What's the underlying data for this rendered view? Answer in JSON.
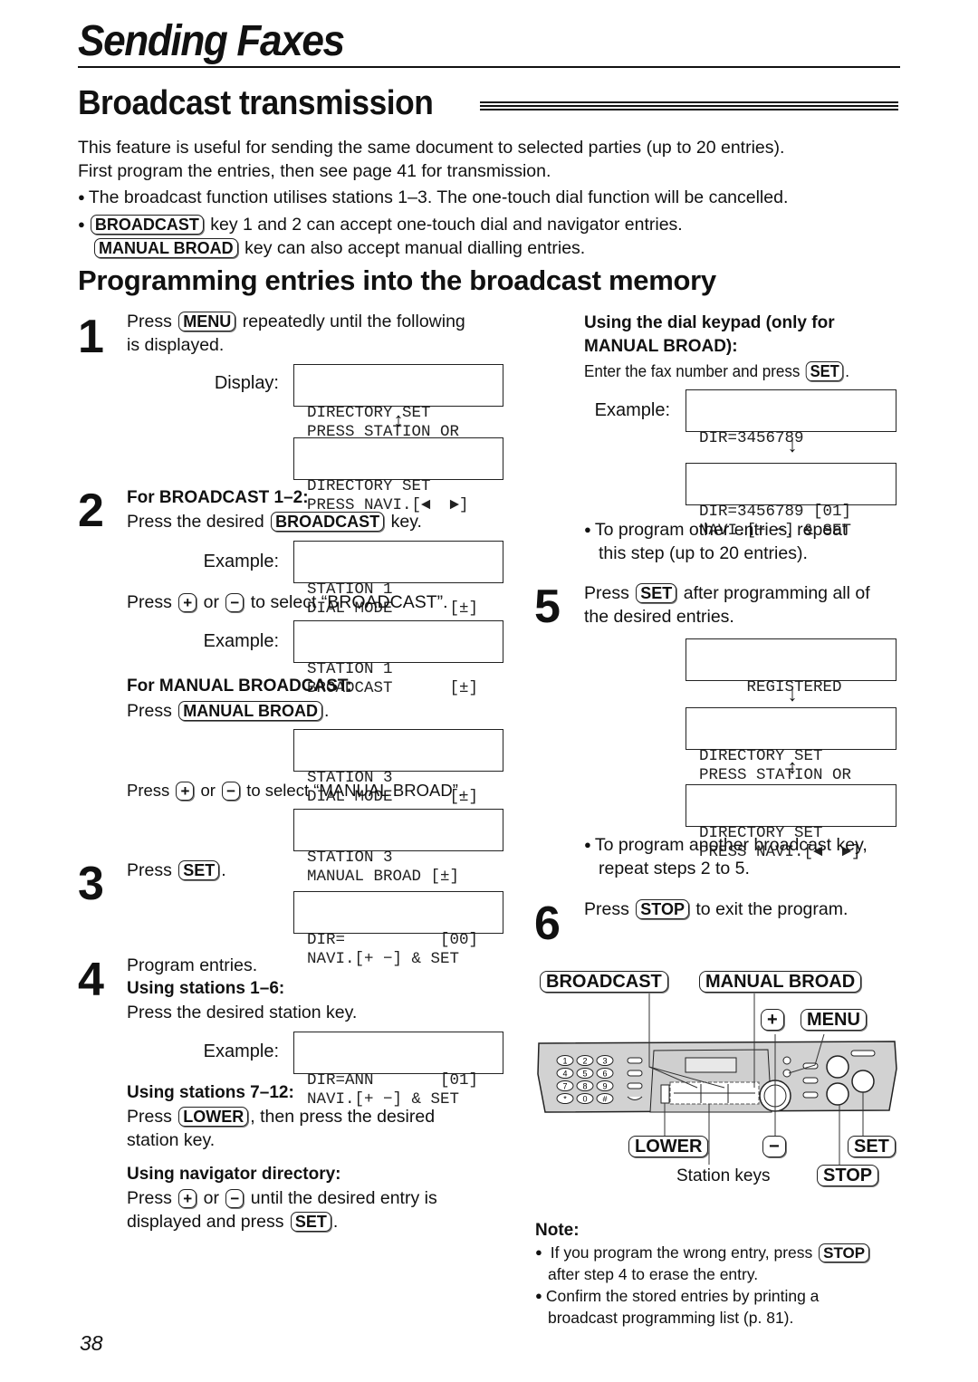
{
  "page": {
    "chapter_title": "Sending Faxes",
    "section_title": "Broadcast transmission",
    "sub_title": "Programming entries into the broadcast memory",
    "page_number": "38"
  },
  "intro": {
    "line1": "This feature is useful for sending the same document to selected parties (up to 20 entries).",
    "line2": "First program the entries, then see page 41 for transmission.",
    "bullet1": "The broadcast function utilises stations 1–3. The one-touch dial function will be cancelled.",
    "bullet2_key": "BROADCAST",
    "bullet2_text": "key 1 and 2 can accept one-touch dial and navigator entries.",
    "bullet2b_key": "MANUAL BROAD",
    "bullet2b_text": "key can also accept manual dialling entries."
  },
  "keys": {
    "menu": "MENU",
    "broadcast": "BROADCAST",
    "manual_broad": "MANUAL BROAD",
    "plus": "+",
    "minus": "−",
    "set": "SET",
    "lower": "LOWER",
    "stop": "STOP"
  },
  "step1": {
    "num": "1",
    "press": "Press",
    "text_after": "repeatedly until the following",
    "text_line2": "is displayed.",
    "display_label": "Display:",
    "lcd1": [
      "DIRECTORY SET",
      "PRESS STATION OR"
    ],
    "lcd2": [
      "DIRECTORY SET",
      "PRESS NAVI.[◄  ►]"
    ]
  },
  "step2": {
    "num": "2",
    "heading": "For BROADCAST 1–2:",
    "press_the_desired": "Press the desired",
    "key_word": "key.",
    "example_label": "Example:",
    "lcd1": [
      "STATION 1",
      "DIAL MODE      [±]"
    ],
    "press": "Press",
    "or": "or",
    "select_text": "to select “BROADCAST”.",
    "lcd2": [
      "STATION 1",
      "BROADCAST      [±]"
    ],
    "manual_heading": "For MANUAL BROADCAST:",
    "manual_press": "Press",
    "lcd3": [
      "STATION 3",
      "DIAL MODE      [±]"
    ],
    "select_manual_text": "to select “MANUAL BROAD”.",
    "lcd4": [
      "STATION 3",
      "MANUAL BROAD [±]"
    ]
  },
  "step3": {
    "num": "3",
    "press": "Press",
    "lcd": [
      "DIR=          [00]",
      "NAVI.[+ −] & SET"
    ]
  },
  "step4": {
    "num": "4",
    "line1": "Program entries.",
    "h1": "Using stations 1–6:",
    "t1": "Press the desired station key.",
    "example_label": "Example:",
    "lcd": [
      "DIR=ANN       [01]",
      "NAVI.[+ −] & SET"
    ],
    "h2": "Using stations 7–12:",
    "t2a_press": "Press",
    "t2a_after": ", then press the desired",
    "t2b": "station key.",
    "h3": "Using navigator directory:",
    "t3_press": "Press",
    "t3_or": "or",
    "t3_after": "until the desired entry is",
    "t3b_before": "displayed and press"
  },
  "keypad": {
    "h1": "Using the dial keypad (only for",
    "h2": "MANUAL BROAD):",
    "text": "Enter the fax number and press",
    "example_label": "Example:",
    "lcd1": [
      "DIR=3456789",
      ""
    ],
    "lcd2": [
      "DIR=3456789 [01]",
      "NAVI.[+ −] & SET"
    ],
    "bullet_l1": "To program other entries, repeat",
    "bullet_l2": "this step (up to 20 entries)."
  },
  "step5": {
    "num": "5",
    "press": "Press",
    "after": "after programming all of",
    "line2": "the desired entries.",
    "lcd1": [
      "     REGISTERED",
      ""
    ],
    "lcd2": [
      "DIRECTORY SET",
      "PRESS STATION OR"
    ],
    "lcd3": [
      "DIRECTORY SET",
      "PRESS NAVI.[◄  ►]"
    ],
    "bullet_l1": "To program another broadcast key,",
    "bullet_l2": "repeat steps 2 to 5."
  },
  "step6": {
    "num": "6",
    "press": "Press",
    "after": "to exit the program."
  },
  "diagram": {
    "callouts": {
      "broadcast": "BROADCAST",
      "manual_broad": "MANUAL BROAD",
      "plus": "+",
      "menu": "MENU",
      "lower": "LOWER",
      "minus": "−",
      "set": "SET",
      "stop": "STOP"
    },
    "station_keys_label": "Station keys",
    "dial_keys": [
      "1",
      "2",
      "3",
      "4",
      "5",
      "6",
      "7",
      "8",
      "9",
      "*",
      "0",
      "#"
    ]
  },
  "note": {
    "title": "Note:",
    "b1_l1": "If you program the wrong entry, press",
    "b1_l2": "after step 4 to erase the entry.",
    "b2_l1": "Confirm the stored entries by printing a",
    "b2_l2": "broadcast programming list (p. 81)."
  }
}
